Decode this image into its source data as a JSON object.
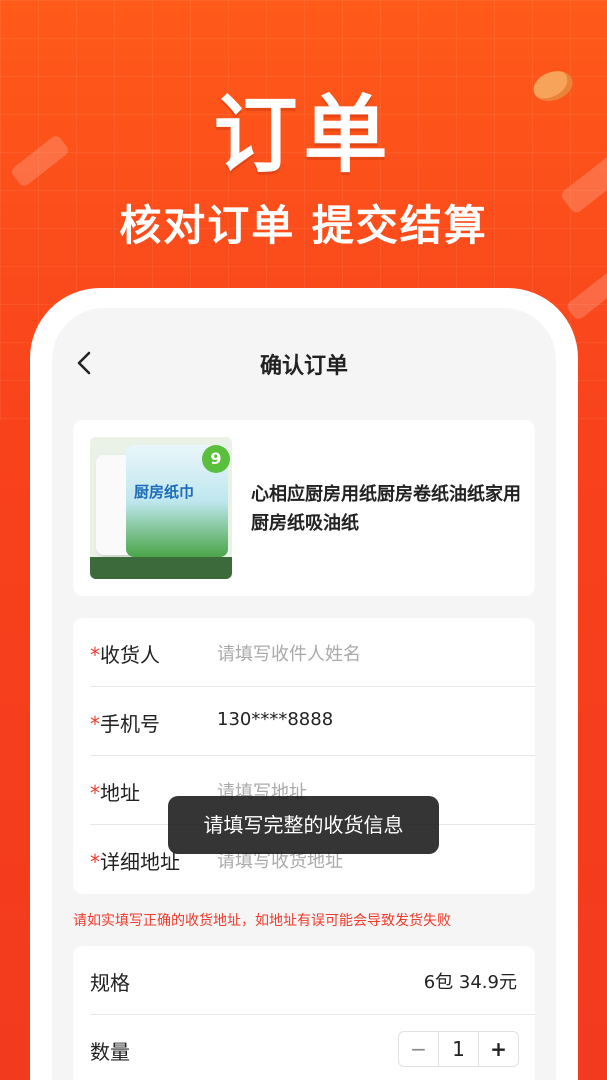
{
  "hero": {
    "title": "订单",
    "subtitle": "核对订单 提交结算"
  },
  "nav": {
    "title": "确认订单",
    "back_icon": "chevron-left-icon"
  },
  "product": {
    "name": "心相应厨房用纸厨房卷纸油纸家用厨房纸吸油纸",
    "thumb_label": "厨房纸巾",
    "thumb_badge": "9"
  },
  "form": {
    "required_mark": "*",
    "fields": [
      {
        "label": "收货人",
        "value": "请填写收件人姓名",
        "filled": false
      },
      {
        "label": "手机号",
        "value": "130****8888",
        "filled": true
      },
      {
        "label": "地址",
        "value": "请填写地址",
        "filled": false
      },
      {
        "label": "详细地址",
        "value": "请填写收货地址",
        "filled": false
      }
    ]
  },
  "warning": "请如实填写正确的收货地址，如地址有误可能会导致发货失败",
  "spec": {
    "spec_label": "规格",
    "spec_value": "6包 34.9元",
    "qty_label": "数量",
    "qty_value": "1",
    "minus": "−",
    "plus": "+"
  },
  "toast": "请填写完整的收货信息",
  "colors": {
    "accent": "#f23a1e",
    "required": "#f03a2b"
  }
}
